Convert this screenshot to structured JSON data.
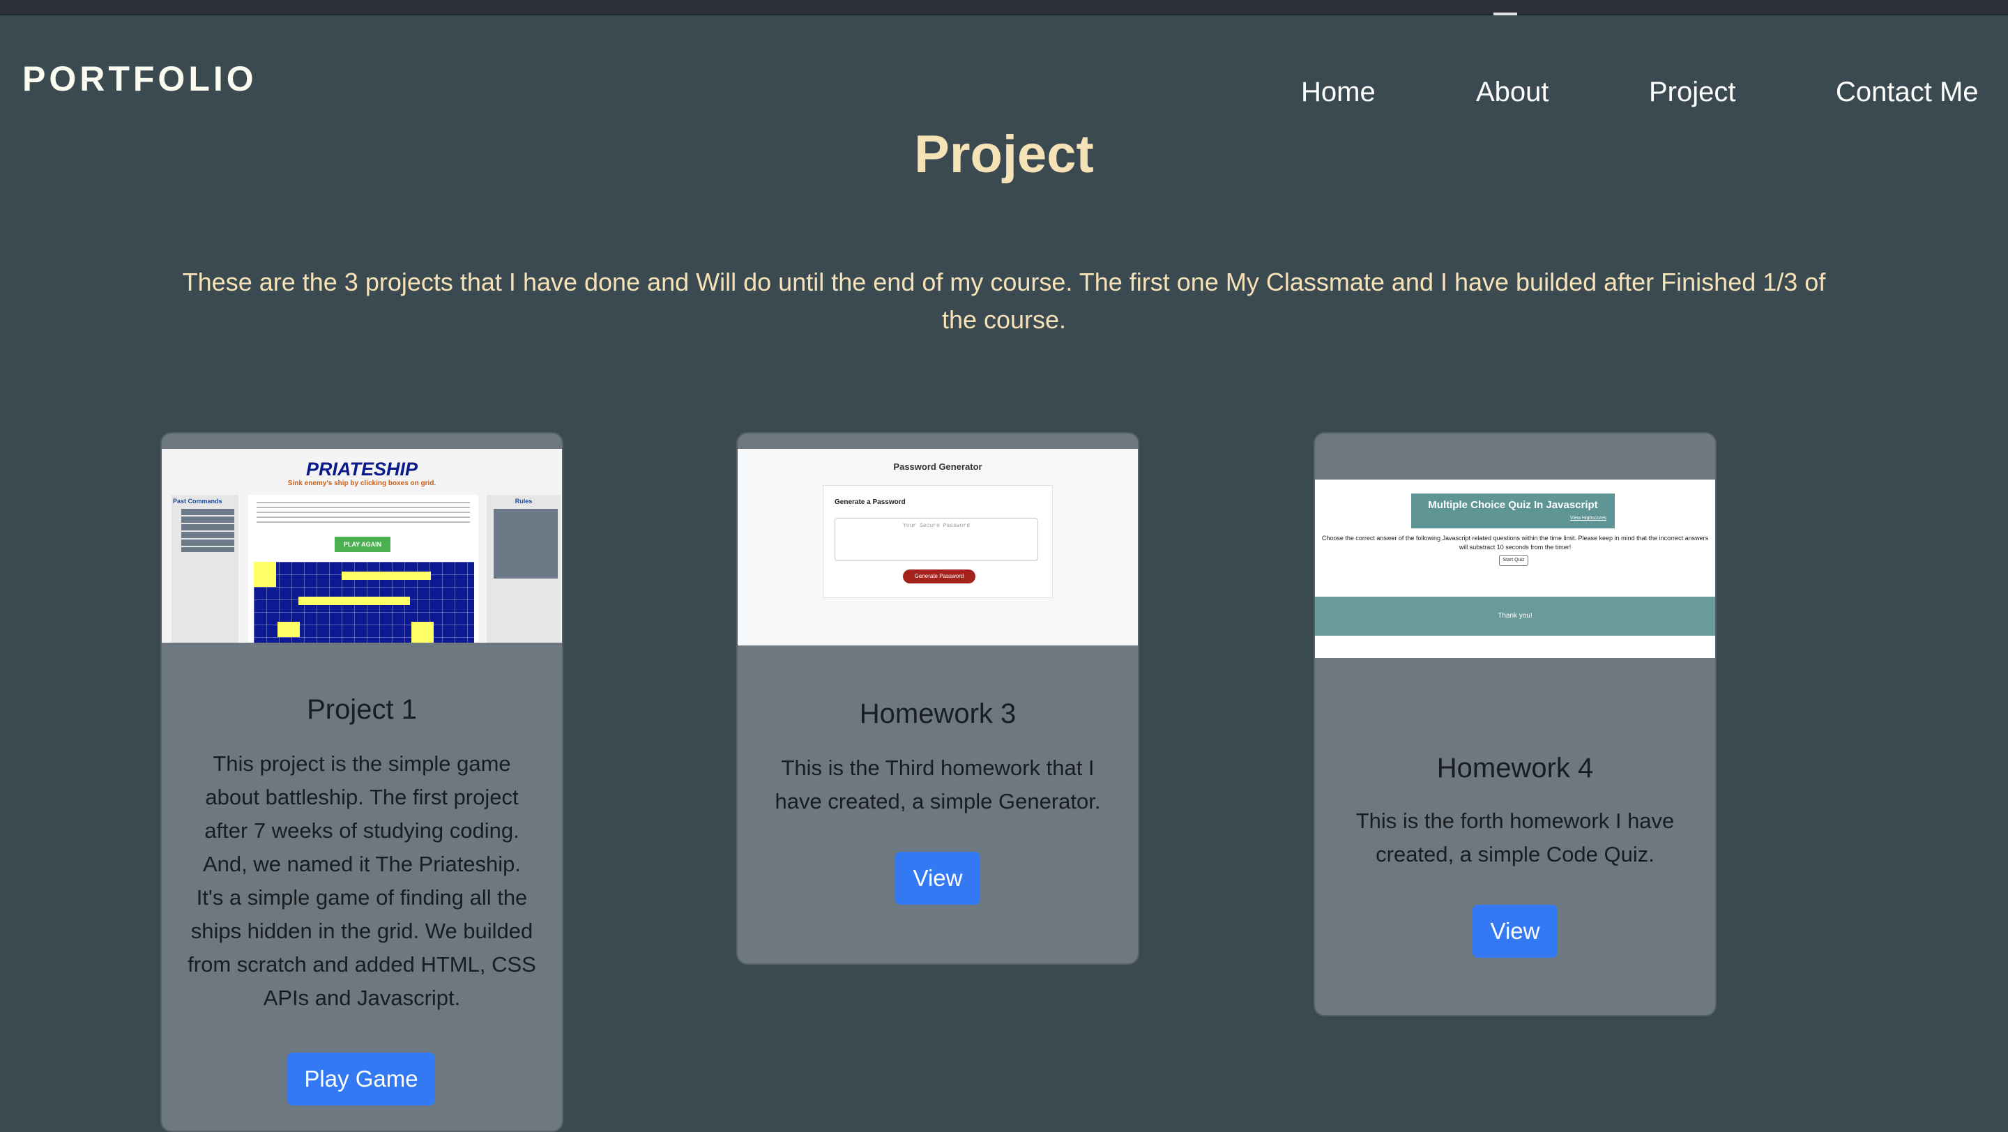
{
  "header": {
    "brand": "PORTFOLIO",
    "nav": [
      {
        "label": "Home"
      },
      {
        "label": "About"
      },
      {
        "label": "Project"
      },
      {
        "label": "Contact Me"
      }
    ]
  },
  "main": {
    "title": "Project",
    "intro": "These are the 3 projects that I have done and Will do until the end of my course. The first one My Classmate and I have builded after Finished 1/3 of the course."
  },
  "cards": [
    {
      "title": "Project 1",
      "text": "This project is the simple game about battleship. The first project after 7 weeks of studying coding. And, we named it The Priateship. It's a simple game of finding all the ships hidden in the grid. We builded from scratch and added HTML, CSS APIs and Javascript.",
      "button": "Play Game",
      "thumb": {
        "title": "PRIATESHIP",
        "subtitle": "Sink enemy's ship by clicking boxes on grid.",
        "left_header": "Past Commands",
        "right_header": "Rules",
        "play_again": "PLAY AGAIN"
      }
    },
    {
      "title": "Homework 3",
      "text": "This is the Third homework that I have created, a simple Generator.",
      "button": "View",
      "thumb": {
        "title": "Password Generator",
        "label": "Generate a Password",
        "placeholder": "Your Secure Password",
        "button": "Generate Password"
      }
    },
    {
      "title": "Homework 4",
      "text": "This is the forth homework I have created, a simple Code Quiz.",
      "button": "View",
      "thumb": {
        "title": "Multiple Choice Quiz In Javascript",
        "highscores": "View Highscores",
        "description": "Choose the correct answer of the following Javascript related questions within the time limit. Please keep in mind that the incorrect answers will substract 10 seconds from the timer!",
        "start": "Start Quiz",
        "footer": "Thank you!"
      }
    }
  ],
  "colors": {
    "background": "#3b4951",
    "title": "#f6e2b7",
    "card": "#6d7880",
    "button": "#3479f4"
  }
}
